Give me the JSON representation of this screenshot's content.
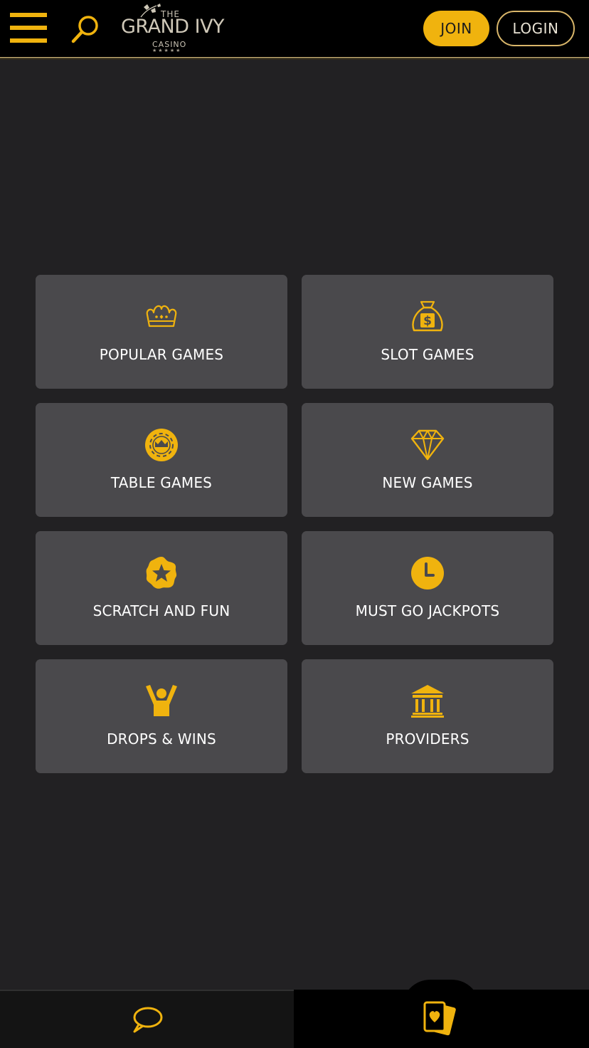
{
  "header": {
    "logo": {
      "the": "THE",
      "name": "GRAND IVY",
      "casino": "CASINO",
      "stars": "★★★★★"
    },
    "join_label": "JOIN",
    "login_label": "LOGIN"
  },
  "categories": [
    {
      "label": "POPULAR GAMES",
      "icon": "crown-icon"
    },
    {
      "label": "SLOT GAMES",
      "icon": "money-bag-icon"
    },
    {
      "label": "TABLE GAMES",
      "icon": "poker-chip-icon"
    },
    {
      "label": "NEW GAMES",
      "icon": "diamond-icon"
    },
    {
      "label": "SCRATCH AND FUN",
      "icon": "scratch-star-icon"
    },
    {
      "label": "MUST GO JACKPOTS",
      "icon": "clock-icon"
    },
    {
      "label": "DROPS & WINS",
      "icon": "cheering-person-icon"
    },
    {
      "label": "PROVIDERS",
      "icon": "bank-building-icon"
    }
  ],
  "bottom_nav": {
    "left_icon": "chat-bubble-icon",
    "right_icon": "playing-cards-icon"
  },
  "colors": {
    "accent": "#f0b30e",
    "background": "#222123",
    "tile": "#4a494c",
    "header": "#000000"
  }
}
